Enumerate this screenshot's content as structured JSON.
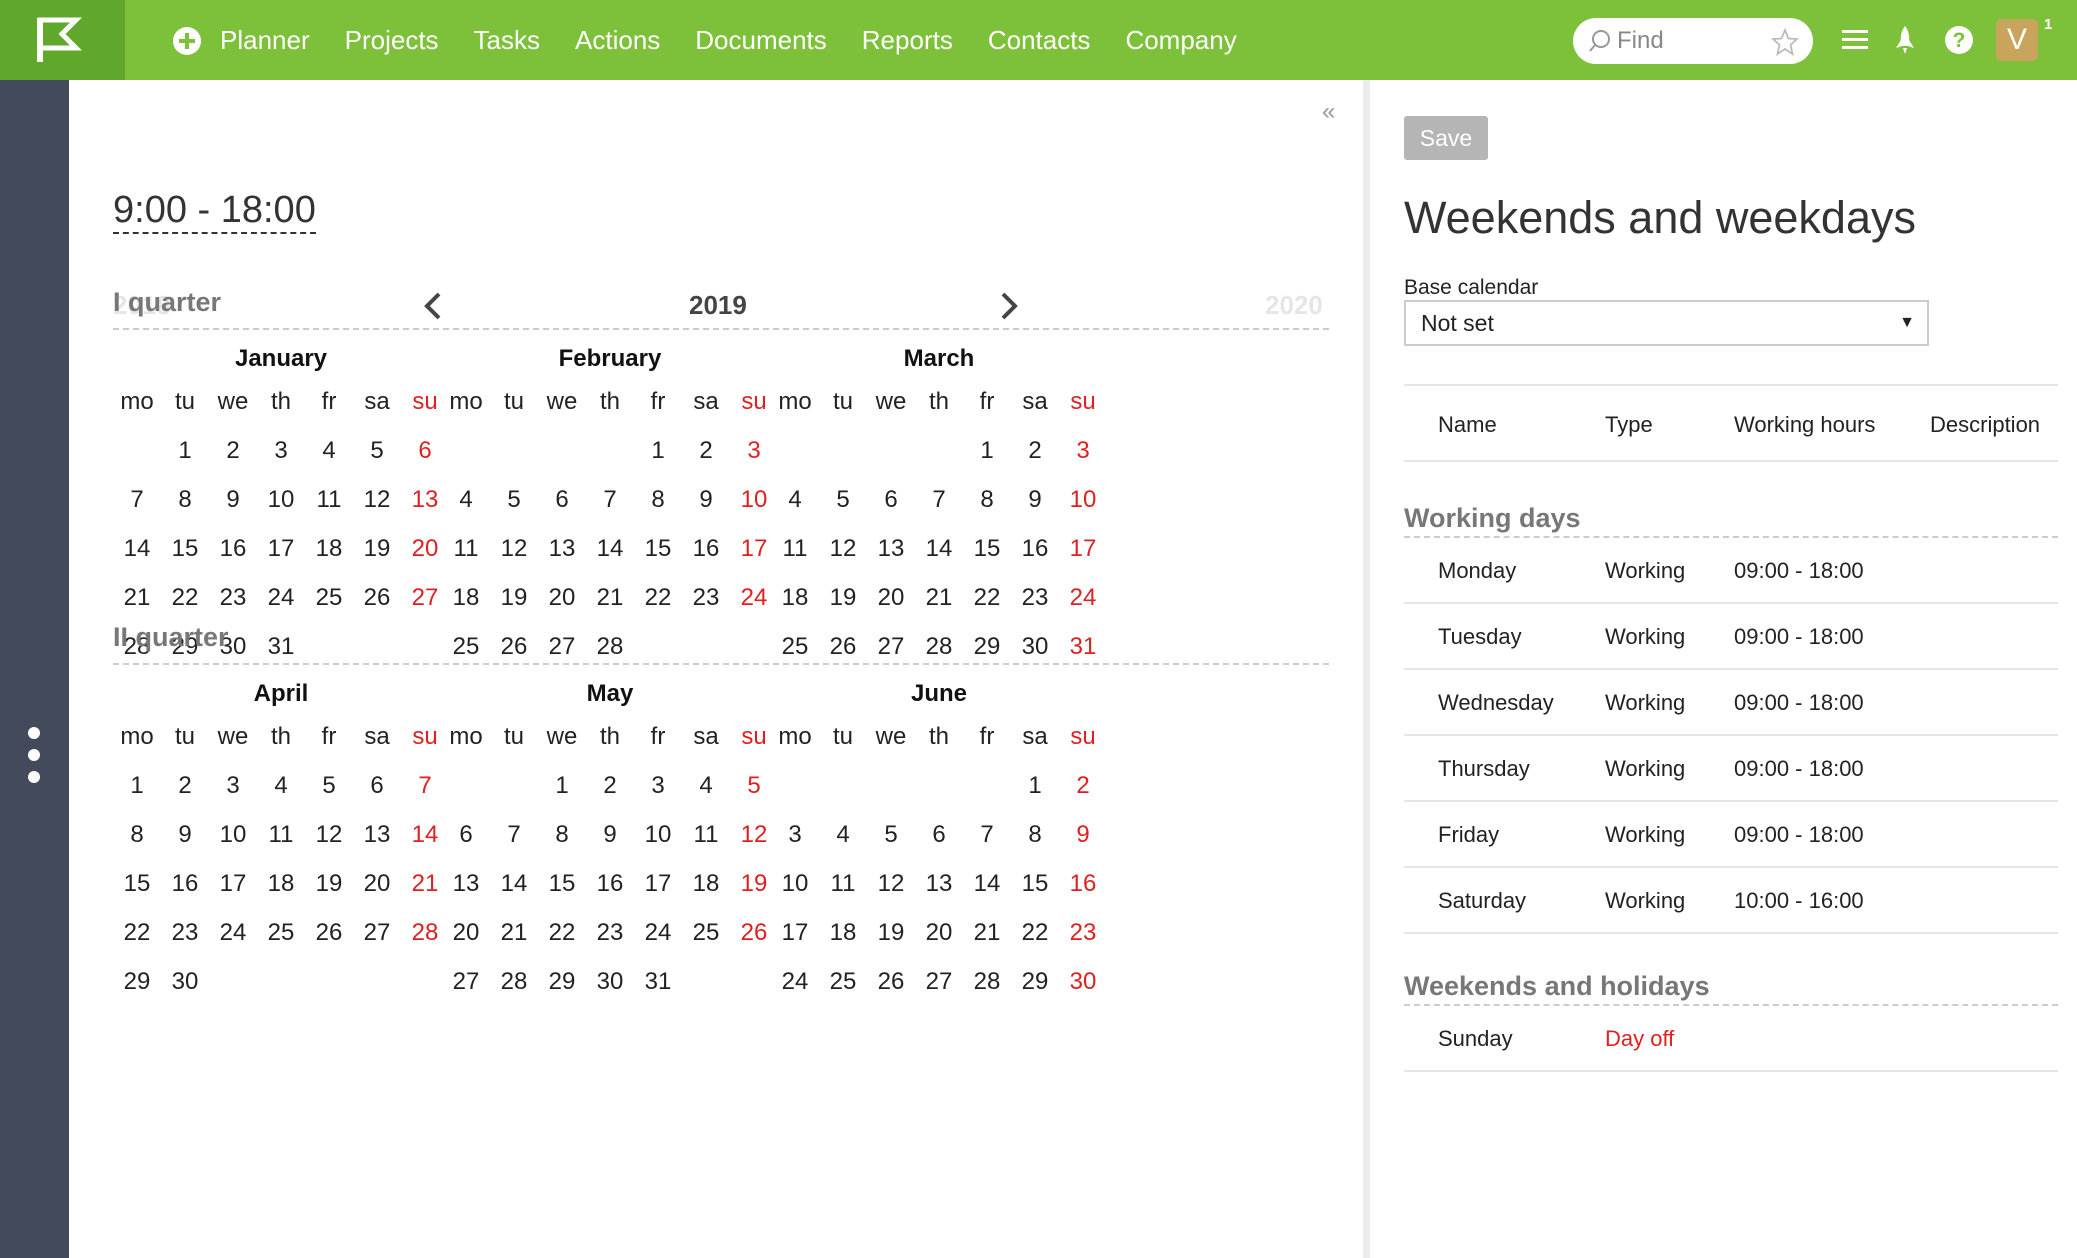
{
  "topbar": {
    "nav": [
      "Planner",
      "Projects",
      "Tasks",
      "Actions",
      "Documents",
      "Reports",
      "Contacts",
      "Company"
    ],
    "find_placeholder": "Find",
    "avatar_letter": "V",
    "notification_count": "1",
    "colors": {
      "bar": "#7dc13a",
      "logo_block": "#5fa82b"
    }
  },
  "calendar": {
    "working_hours_link": "9:00 - 18:00",
    "collapse_icon": "«",
    "year_prev": "2018",
    "year_current": "2019",
    "year_next": "2020",
    "weekday_headers": [
      "mo",
      "tu",
      "we",
      "th",
      "fr",
      "sa",
      "su"
    ],
    "quarters": [
      {
        "title": "I quarter",
        "months": [
          {
            "name": "January",
            "offset": 1,
            "days": 31
          },
          {
            "name": "February",
            "offset": 4,
            "days": 28
          },
          {
            "name": "March",
            "offset": 4,
            "days": 31
          }
        ]
      },
      {
        "title": "II quarter",
        "months": [
          {
            "name": "April",
            "offset": 0,
            "days": 30
          },
          {
            "name": "May",
            "offset": 2,
            "days": 31
          },
          {
            "name": "June",
            "offset": 5,
            "days": 30
          }
        ]
      }
    ],
    "weekend_color": "#e02020"
  },
  "right_panel": {
    "save_label": "Save",
    "title": "Weekends and weekdays",
    "base_calendar_label": "Base calendar",
    "base_calendar_value": "Not set",
    "columns": [
      "Name",
      "Type",
      "Working hours",
      "Description"
    ],
    "working_days_title": "Working days",
    "working_days": [
      {
        "name": "Monday",
        "type": "Working",
        "hours": "09:00 - 18:00"
      },
      {
        "name": "Tuesday",
        "type": "Working",
        "hours": "09:00 - 18:00"
      },
      {
        "name": "Wednesday",
        "type": "Working",
        "hours": "09:00 - 18:00"
      },
      {
        "name": "Thursday",
        "type": "Working",
        "hours": "09:00 - 18:00"
      },
      {
        "name": "Friday",
        "type": "Working",
        "hours": "09:00 - 18:00"
      },
      {
        "name": "Saturday",
        "type": "Working",
        "hours": "10:00 - 16:00"
      }
    ],
    "weekends_title": "Weekends and holidays",
    "weekends": [
      {
        "name": "Sunday",
        "type": "Day off",
        "hours": ""
      }
    ]
  }
}
